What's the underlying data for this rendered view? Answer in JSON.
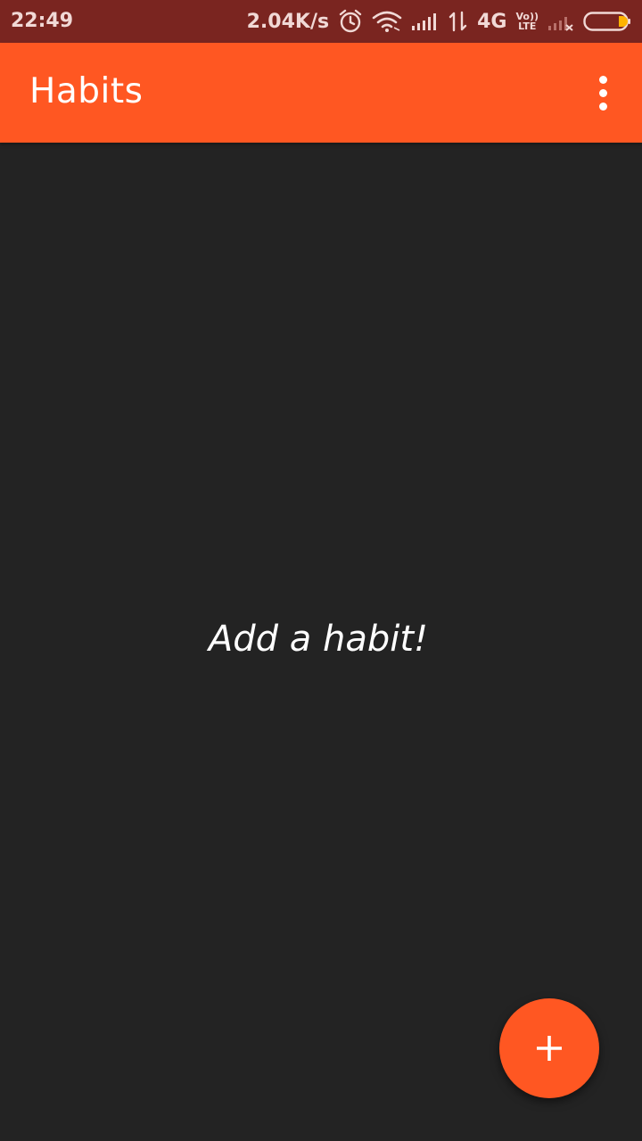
{
  "status_bar": {
    "time": "22:49",
    "net_speed": "2.04K/s",
    "network_type": "4G",
    "volte_top": "Vo))",
    "volte_bottom": "LTE",
    "icons": [
      "alarm-icon",
      "wifi-icon",
      "signal-icon",
      "data-arrows-icon",
      "volte-icon",
      "no-signal-icon",
      "battery-icon"
    ],
    "battery_level": 0.15
  },
  "app_bar": {
    "title": "Habits",
    "menu_icon": "more-vert-icon"
  },
  "main": {
    "empty_message": "Add a habit!"
  },
  "fab": {
    "icon": "add-icon"
  },
  "colors": {
    "primary": "#ff5722",
    "status_bar": "#7a2520",
    "background": "#232323",
    "text": "#ffffff"
  }
}
